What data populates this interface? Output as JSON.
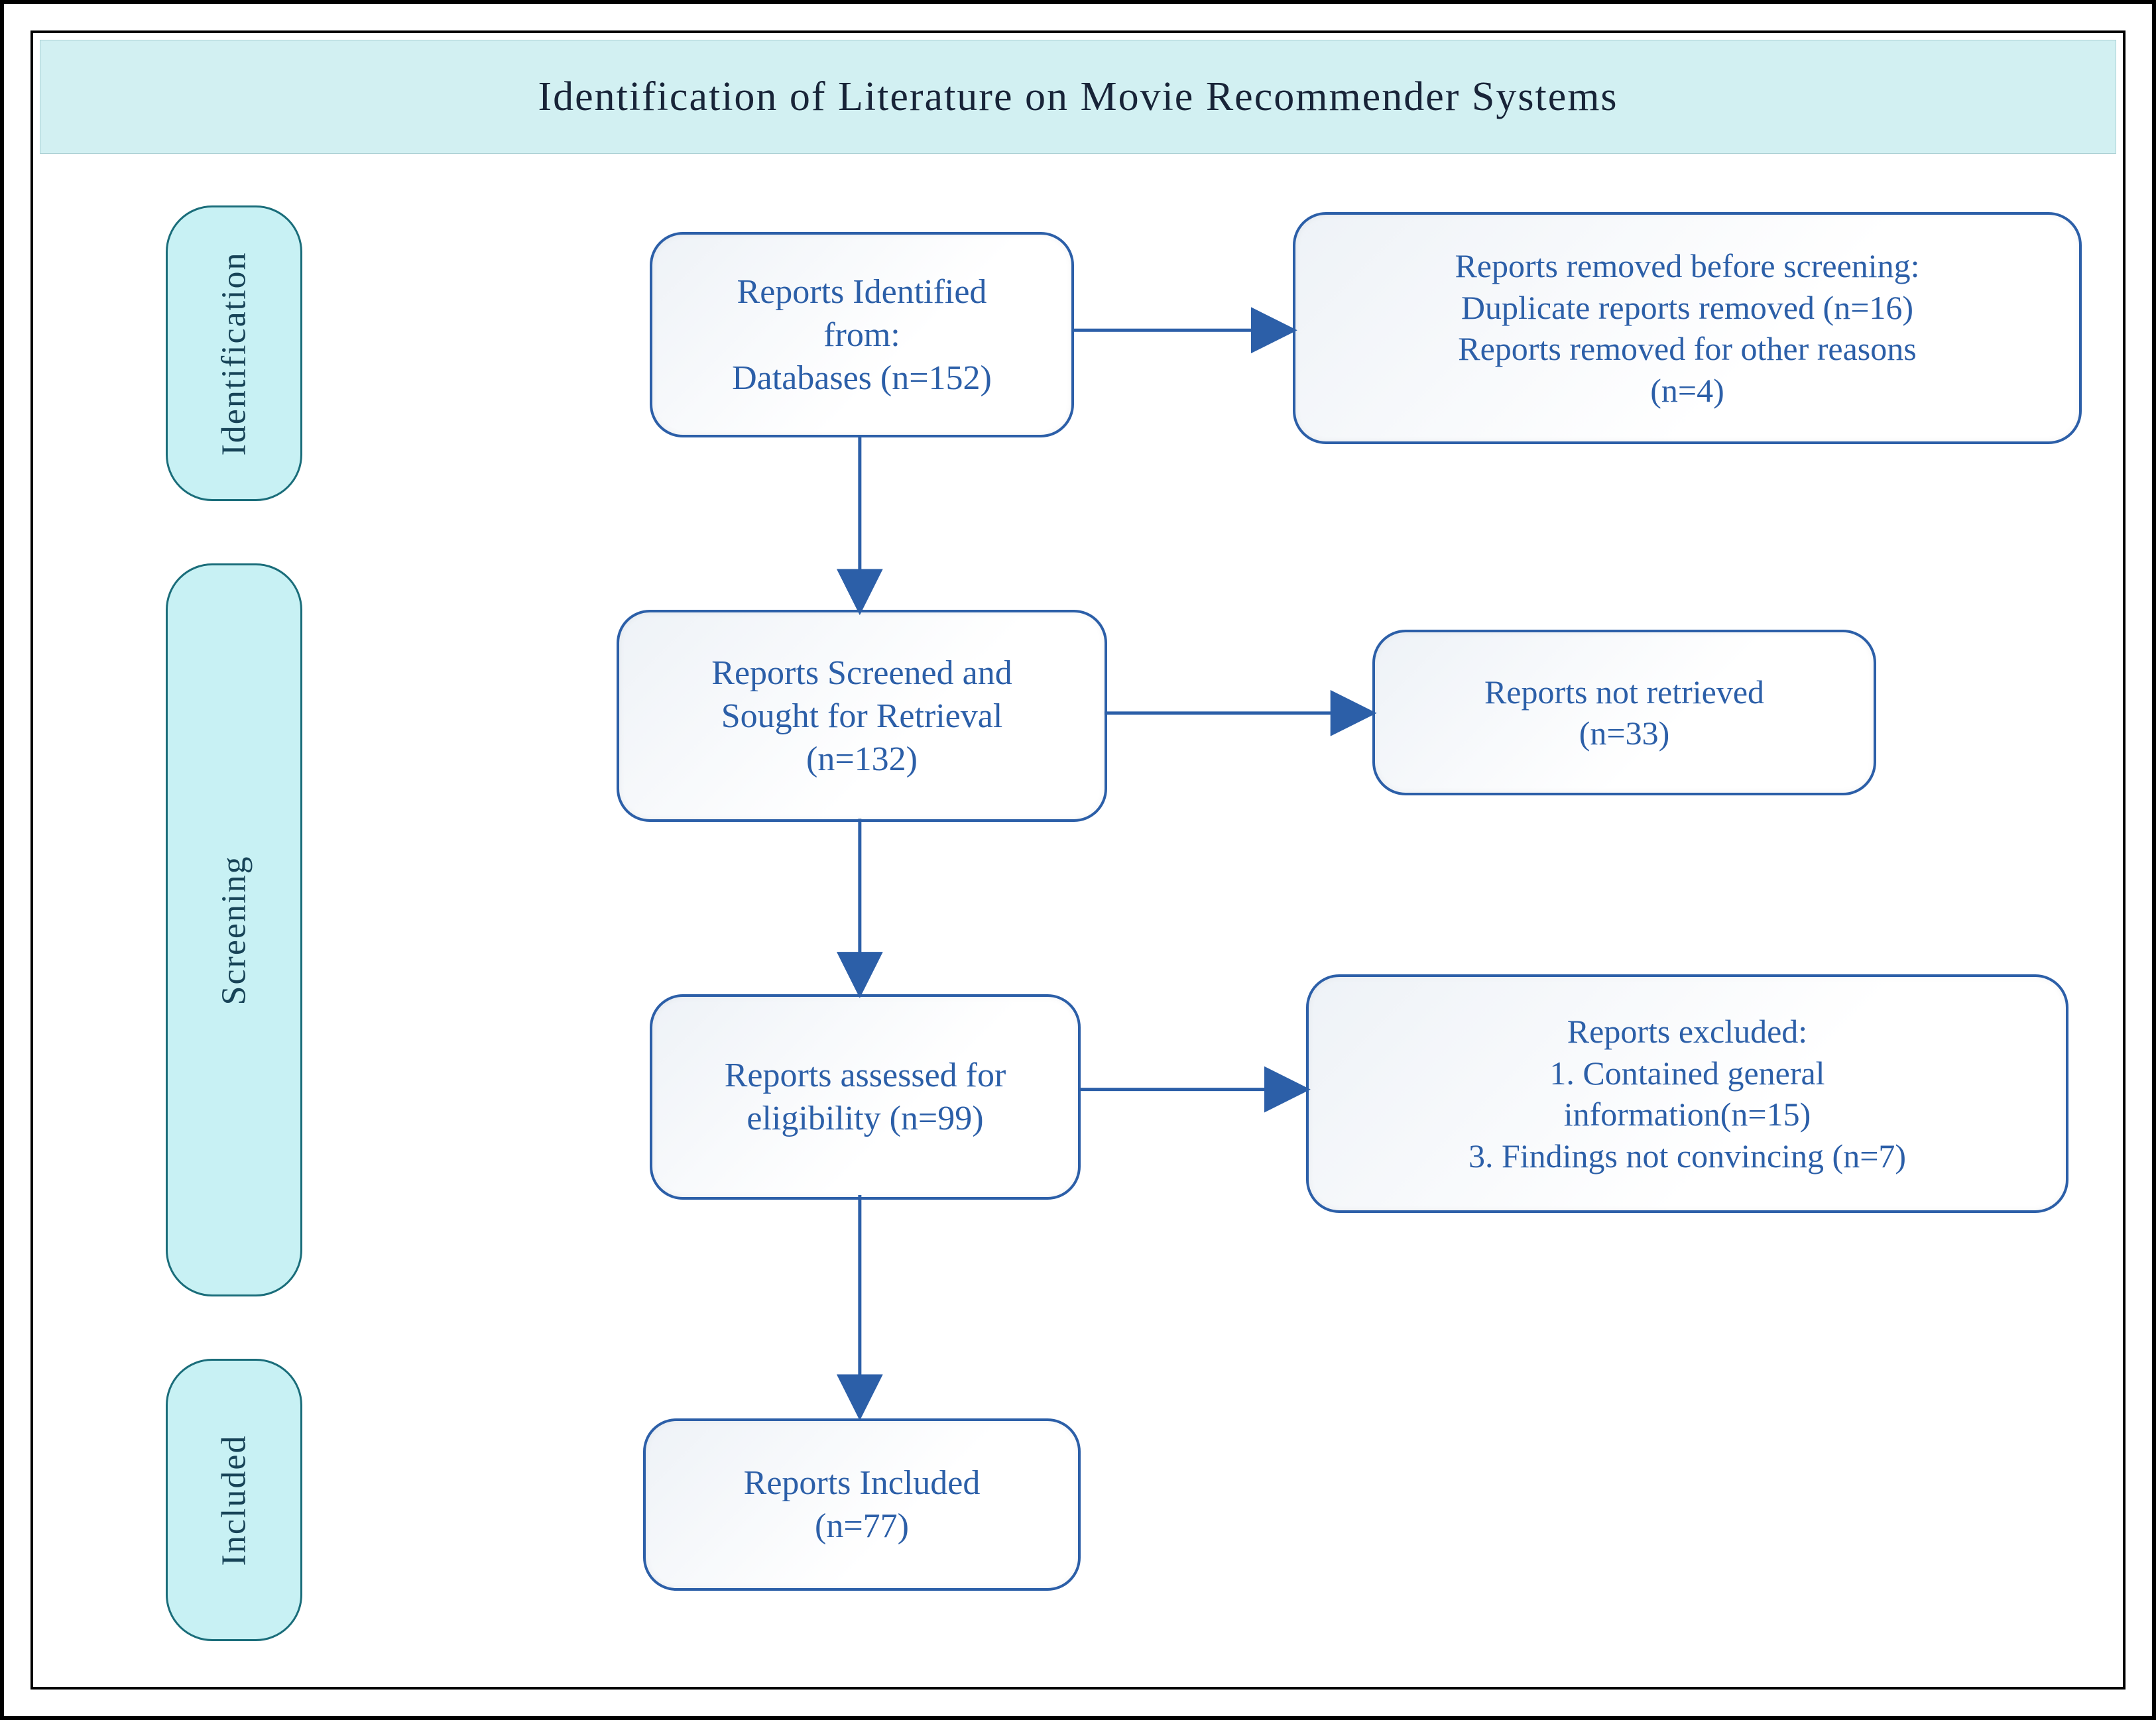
{
  "title": "Identification of Literature on Movie Recommender Systems",
  "stages": {
    "identification": "Identification",
    "screening": "Screening",
    "included": "Included"
  },
  "boxes": {
    "identified": {
      "line1": "Reports Identified",
      "line2": "from:",
      "line3": "Databases (n=152)"
    },
    "removed_before": {
      "line1": "Reports removed before screening:",
      "line2": "Duplicate reports removed (n=16)",
      "line3": "Reports removed for other reasons",
      "line4": "(n=4)"
    },
    "screened": {
      "line1": "Reports Screened and",
      "line2": "Sought for Retrieval",
      "line3": "(n=132)"
    },
    "not_retrieved": {
      "line1": "Reports not retrieved",
      "line2": "(n=33)"
    },
    "assessed": {
      "line1": "Reports assessed for",
      "line2": "eligibility (n=99)"
    },
    "excluded": {
      "line1": "Reports excluded:",
      "line2": "1. Contained general",
      "line3": "information(n=15)",
      "line4": "3. Findings not convincing (n=7)"
    },
    "included_box": {
      "line1": "Reports Included",
      "line2": "(n=77)"
    }
  },
  "chart_data": {
    "type": "flow",
    "title": "Identification of Literature on Movie Recommender Systems",
    "stages": [
      {
        "name": "Identification",
        "nodes": [
          "identified",
          "removed_before"
        ]
      },
      {
        "name": "Screening",
        "nodes": [
          "screened",
          "not_retrieved",
          "assessed",
          "excluded"
        ]
      },
      {
        "name": "Included",
        "nodes": [
          "included_box"
        ]
      }
    ],
    "nodes": {
      "identified": {
        "label": "Reports Identified from: Databases",
        "n": 152
      },
      "removed_before": {
        "label": "Reports removed before screening",
        "breakdown": {
          "Duplicate reports removed": 16,
          "Reports removed for other reasons": 4
        }
      },
      "screened": {
        "label": "Reports Screened and Sought for Retrieval",
        "n": 132
      },
      "not_retrieved": {
        "label": "Reports not retrieved",
        "n": 33
      },
      "assessed": {
        "label": "Reports assessed for eligibility",
        "n": 99
      },
      "excluded": {
        "label": "Reports excluded",
        "breakdown": {
          "Contained general information": 15,
          "Findings not convincing": 7
        }
      },
      "included_box": {
        "label": "Reports Included",
        "n": 77
      }
    },
    "edges": [
      {
        "from": "identified",
        "to": "removed_before"
      },
      {
        "from": "identified",
        "to": "screened"
      },
      {
        "from": "screened",
        "to": "not_retrieved"
      },
      {
        "from": "screened",
        "to": "assessed"
      },
      {
        "from": "assessed",
        "to": "excluded"
      },
      {
        "from": "assessed",
        "to": "included_box"
      }
    ]
  }
}
